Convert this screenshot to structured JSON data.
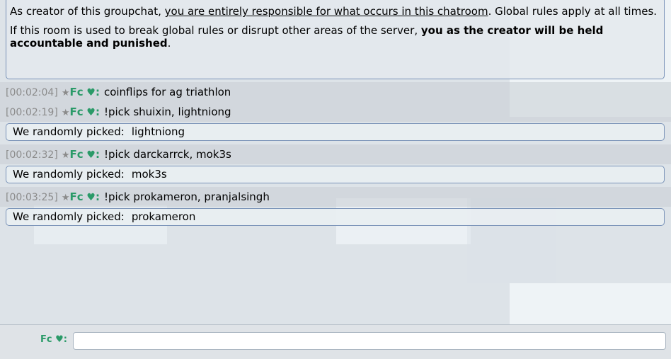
{
  "rules": {
    "line1_pre": "As creator of this groupchat, ",
    "line1_underline": "you are entirely responsible for what occurs in this chatroom",
    "line1_post": ". Global rules apply at all times.",
    "line2_pre": "If this room is used to break global rules or disrupt other areas of the server, ",
    "line2_bold": "you as the creator will be held accountable and punished",
    "line2_post": "."
  },
  "user": {
    "rank_symbol": "★",
    "name": "Fc",
    "heart": "♥",
    "colon": ":"
  },
  "messages": [
    {
      "timestamp": "[00:02:04]",
      "text": "coinflips for ag triathlon"
    },
    {
      "timestamp": "[00:02:19]",
      "text": "!pick shuixin, lightniong"
    },
    {
      "timestamp": "[00:02:32]",
      "text": "!pick darckarrck, mok3s"
    },
    {
      "timestamp": "[00:03:25]",
      "text": "!pick prokameron, pranjalsingh"
    }
  ],
  "picks": [
    {
      "label": "We randomly picked:",
      "value": "lightniong"
    },
    {
      "label": "We randomly picked:",
      "value": "mok3s"
    },
    {
      "label": "We randomly picked:",
      "value": "prokameron"
    }
  ],
  "input": {
    "label_name": "Fc",
    "label_heart": "♥",
    "label_colon": ":",
    "value": "",
    "placeholder": ""
  },
  "colors": {
    "username": "#2a9a68",
    "timestamp": "#8b8b8b",
    "box_border": "#7a93b8"
  }
}
